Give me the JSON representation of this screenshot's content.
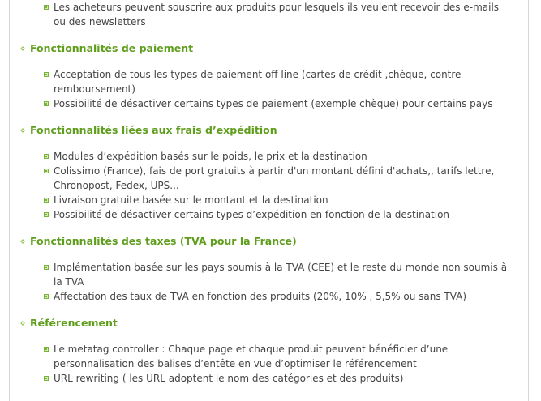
{
  "intro_items": [
    "Les acheteurs peuvent souscrire aux produits pour lesquels ils veulent recevoir des e-mails ou des newsletters"
  ],
  "sections": [
    {
      "title": "Fonctionnalités de paiement",
      "items": [
        "Acceptation de tous les  types de paiement off line (cartes de crédit ,chèque, contre remboursement)",
        "Possibilité de désactiver certains types de paiement (exemple chèque)  pour certains pays"
      ]
    },
    {
      "title": "Fonctionnalités liées aux frais d’expédition",
      "items": [
        "Modules d’expédition  basés sur le poids, le prix et la destination",
        "Colissimo (France), fais de port gratuits à partir d'un montant défini d'achats,, tarifs lettre, Chronopost, Fedex, UPS...",
        "Livraison gratuite basée sur le montant et la destination",
        "Possibilité de désactiver certains types d’expédition en fonction de la destination"
      ]
    },
    {
      "title": "Fonctionnalités des taxes (TVA pour la France)",
      "items": [
        "Implémentation basée sur les pays soumis à la TVA (CEE) et le reste du monde non soumis à la TVA",
        "Affectation des taux de TVA en fonction des produits (20%, 10% , 5,5% ou sans TVA)"
      ]
    },
    {
      "title": "Référencement",
      "items": [
        "Le metatag controller : Chaque page et chaque produit peuvent bénéficier d’une personnalisation des balises d’entête en vue d’optimiser le référencement",
        "URL rewriting  ( les URL adoptent le nom  des catégories et des produits)"
      ]
    }
  ],
  "colors": {
    "heading": "#5f9e1c",
    "bullet": "#7bb33a",
    "text": "#444444",
    "border": "#d6d6d6"
  },
  "icons": {
    "section_marker": "diamond-icon",
    "list_bullet": "square-bullet-icon"
  }
}
